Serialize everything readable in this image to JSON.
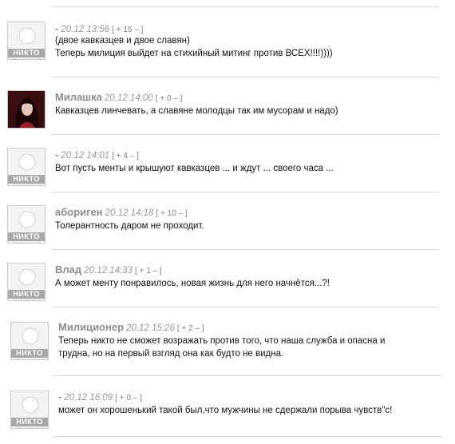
{
  "avatar_placeholder": "НИКТО",
  "comments": [
    {
      "author": "-",
      "date": "20.12 13:56",
      "rating_open": "[ +",
      "score": "15",
      "rating_close": "– ]",
      "lines": [
        "(двое кавказцев и двое славян)",
        "Теперь милиция выйдет на стихийный митинг против ВСЕХ!!!!))))"
      ]
    },
    {
      "author": "Милашка",
      "date": "20.12 14:00",
      "rating_open": "[ +",
      "score": "0",
      "rating_close": "– ]",
      "lines": [
        "Кавказцев линчевать, а славяне молодцы так им мусорам и надо)"
      ]
    },
    {
      "author": "-",
      "date": "20.12 14:01",
      "rating_open": "[ +",
      "score": "4",
      "rating_close": "– ]",
      "lines": [
        "Вот пусть менты и крышуют кавказцев ... и ждут ... своего часа ..."
      ]
    },
    {
      "author": "абориген",
      "date": "20.12 14:18",
      "rating_open": "[ +",
      "score": "10",
      "rating_close": "– ]",
      "lines": [
        "Толерантность даром не проходит."
      ]
    },
    {
      "author": "Влад",
      "date": "20.12 14:33",
      "rating_open": "[ +",
      "score": "1",
      "rating_close": "– ]",
      "lines": [
        "А может менту понравилось, новая жизнь для него начнётся...?!"
      ]
    },
    {
      "author": "Милиционер",
      "date": "20.12 15:26",
      "rating_open": "[ +",
      "score": "2",
      "rating_close": "– ]",
      "lines": [
        "Теперь никто не сможет возражать против того, что наша служба и опасна и",
        "трудна, но на первый взгляд она как будто не видна."
      ]
    },
    {
      "author": "-",
      "date": "20.12 16:09",
      "rating_open": "[ +",
      "score": "0",
      "rating_close": "– ]",
      "lines": [
        "может он хорошенький такой был,что мужчины не сдержали порыва чувств\"с!"
      ]
    }
  ]
}
